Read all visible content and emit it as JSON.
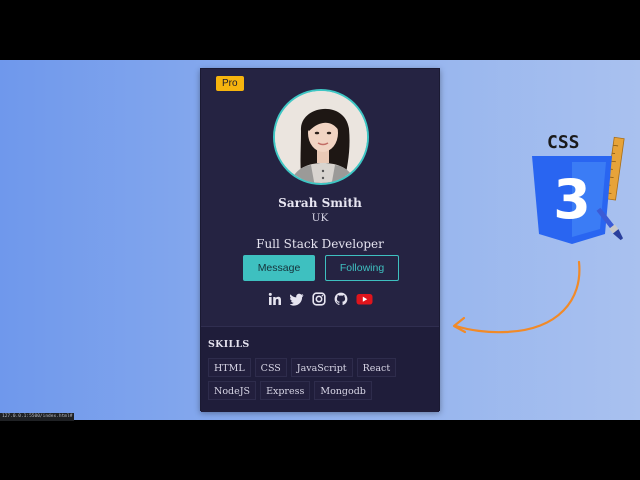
{
  "card": {
    "badge": "Pro",
    "name": "Sarah Smith",
    "location": "UK",
    "role": "Full Stack Developer",
    "message_label": "Message",
    "following_label": "Following"
  },
  "socials": [
    {
      "icon": "linkedin-icon"
    },
    {
      "icon": "twitter-icon"
    },
    {
      "icon": "instagram-icon"
    },
    {
      "icon": "github-icon"
    },
    {
      "icon": "youtube-icon"
    }
  ],
  "skills": {
    "title": "SKILLS",
    "items": [
      "HTML",
      "CSS",
      "JavaScript",
      "React",
      "NodeJS",
      "Express",
      "Mongodb"
    ]
  },
  "decor": {
    "css_logo_text": "CSS",
    "css_logo_number": "3"
  },
  "status_bar": "127.0.0.1:5500/index.html#",
  "colors": {
    "accent": "#3ec0c0",
    "badge": "#f6b40e",
    "card_bg": "#252342",
    "youtube": "#e0141c",
    "css_blue": "#2965f1",
    "arrow": "#f18a28"
  }
}
